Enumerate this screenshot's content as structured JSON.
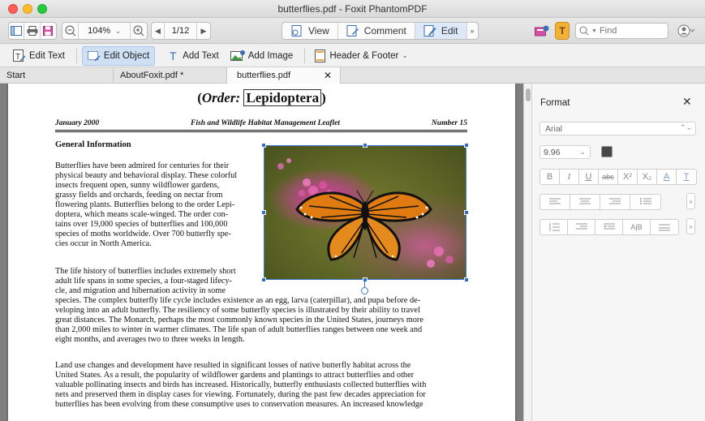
{
  "window": {
    "title": "butterflies.pdf - Foxit PhantomPDF"
  },
  "toolbar": {
    "zoom_value": "104%",
    "page_value": "1/12",
    "modes": [
      {
        "label": "View"
      },
      {
        "label": "Comment"
      },
      {
        "label": "Edit"
      }
    ],
    "find_placeholder": "Find"
  },
  "edit_toolbar": {
    "items": [
      {
        "label": "Edit Text"
      },
      {
        "label": "Edit Object"
      },
      {
        "label": "Add Text"
      },
      {
        "label": "Add Image"
      },
      {
        "label": "Header & Footer"
      }
    ]
  },
  "tabs": [
    {
      "label": "Start"
    },
    {
      "label": "AboutFoxit.pdf *"
    },
    {
      "label": "butterflies.pdf"
    }
  ],
  "document": {
    "title_order": "Order:",
    "title_word": "Lepidoptera",
    "header_left": "January 2000",
    "header_center": "Fish and Wildlife Habitat Management Leaflet",
    "header_right": "Number 15",
    "heading": "General Information",
    "para1_lines": [
      "Butterflies have been admired for centuries for their",
      "physical beauty and behavioral display. These colorful",
      "insects frequent open, sunny wildflower gardens,",
      "grassy fields and orchards, feeding on nectar from",
      "flowering plants.  Butterflies belong to the order Lepi-",
      "doptera, which means scale-winged.  The order con-",
      "tains over 19,000 species of butterflies and 100,000",
      "species of moths worldwide.  Over 700 butterfly spe-",
      "cies occur in North America."
    ],
    "para2_lines": [
      "The life history of butterflies includes extremely short",
      "adult life spans in some species, a four-staged lifecy-",
      "cle, and migration and hibernation activity in some",
      "species.  The complex butterfly life cycle includes existence as an egg, larva (caterpillar), and pupa before de-",
      "veloping into an adult butterfly.  The resiliency of some butterfly species is illustrated by their ability to travel",
      "great distances.  The Monarch, perhaps the most commonly known species in the United States, journeys more",
      "than 2,000 miles to winter in warmer climates.  The life span of adult butterflies ranges between one week and",
      "eight months, and averages two to three weeks in length."
    ],
    "para3_lines": [
      "Land use changes and development have resulted in significant losses of native butterfly habitat across the",
      "United States.  As a result, the popularity of wildflower gardens and plantings to attract butterflies and other",
      "valuable pollinating insects and birds has increased.  Historically, butterfly enthusiasts collected butterflies with",
      "nets and preserved them in display cases for viewing.  Fortunately, during the past few decades appreciation for",
      "butterflies has been evolving from these consumptive uses to conservation measures.  An increased knowledge"
    ]
  },
  "format_panel": {
    "title": "Format",
    "font_name": "Arial",
    "font_size": "9.96",
    "style_buttons": [
      "B",
      "I",
      "U",
      "abc",
      "X²",
      "X₂",
      "A",
      "T"
    ],
    "text_color": "#474747"
  },
  "colors": {
    "accent": "#2f6fd0",
    "selection_border": "#3a78d6",
    "active_tool_bg": "#cfe0f5",
    "doc_background": "#7e7e7e"
  }
}
